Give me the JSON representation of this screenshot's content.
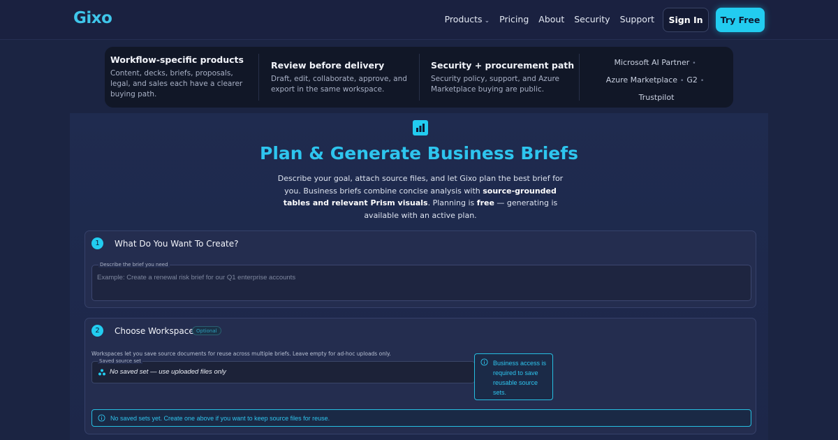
{
  "nav": {
    "logo": "Gixo",
    "links": [
      "Products",
      "Pricing",
      "About",
      "Security",
      "Support"
    ],
    "sign_in": "Sign In",
    "try_free": "Try Free"
  },
  "features": [
    {
      "title": "Workflow-specific products",
      "desc": "Content, decks, briefs, proposals, legal, and sales each have a clearer buying path."
    },
    {
      "title": "Review before delivery",
      "desc": "Draft, edit, collaborate, approve, and export in the same workspace."
    },
    {
      "title": "Security + procurement path",
      "desc": "Security policy, support, and Azure Marketplace buying are public."
    }
  ],
  "trust": {
    "line1": "Microsoft AI Partner",
    "line2a": "Azure Marketplace",
    "line2b": "G2",
    "line3": "Trustpilot"
  },
  "hero": {
    "title": "Plan & Generate Business Briefs",
    "desc_1": "Describe your goal, attach source files, and let Gixo plan the best brief for you. Business briefs combine concise analysis with ",
    "desc_bold_1": "source-grounded tables and relevant Prism visuals",
    "desc_2": ". Planning is ",
    "desc_bold_2": "free",
    "desc_3": " — generating is available with an active plan."
  },
  "step1": {
    "number": "1",
    "title": "What Do You Want To Create?",
    "field_label": "Describe the brief you need",
    "placeholder": "Example: Create a renewal risk brief for our Q1 enterprise accounts"
  },
  "step2": {
    "number": "2",
    "title": "Choose Workspace",
    "badge": "Optional",
    "help": "Workspaces let you save source documents for reuse across multiple briefs. Leave empty for ad-hoc uploads only.",
    "select_label": "Saved source set",
    "select_value": "No saved set — use uploaded files only",
    "tip": "Business access is required to save reusable source sets.",
    "alert": "No saved sets yet. Create one above if you want to keep source files for reuse."
  },
  "colors": {
    "accent": "#22ccf0",
    "background": "#1b2442"
  }
}
